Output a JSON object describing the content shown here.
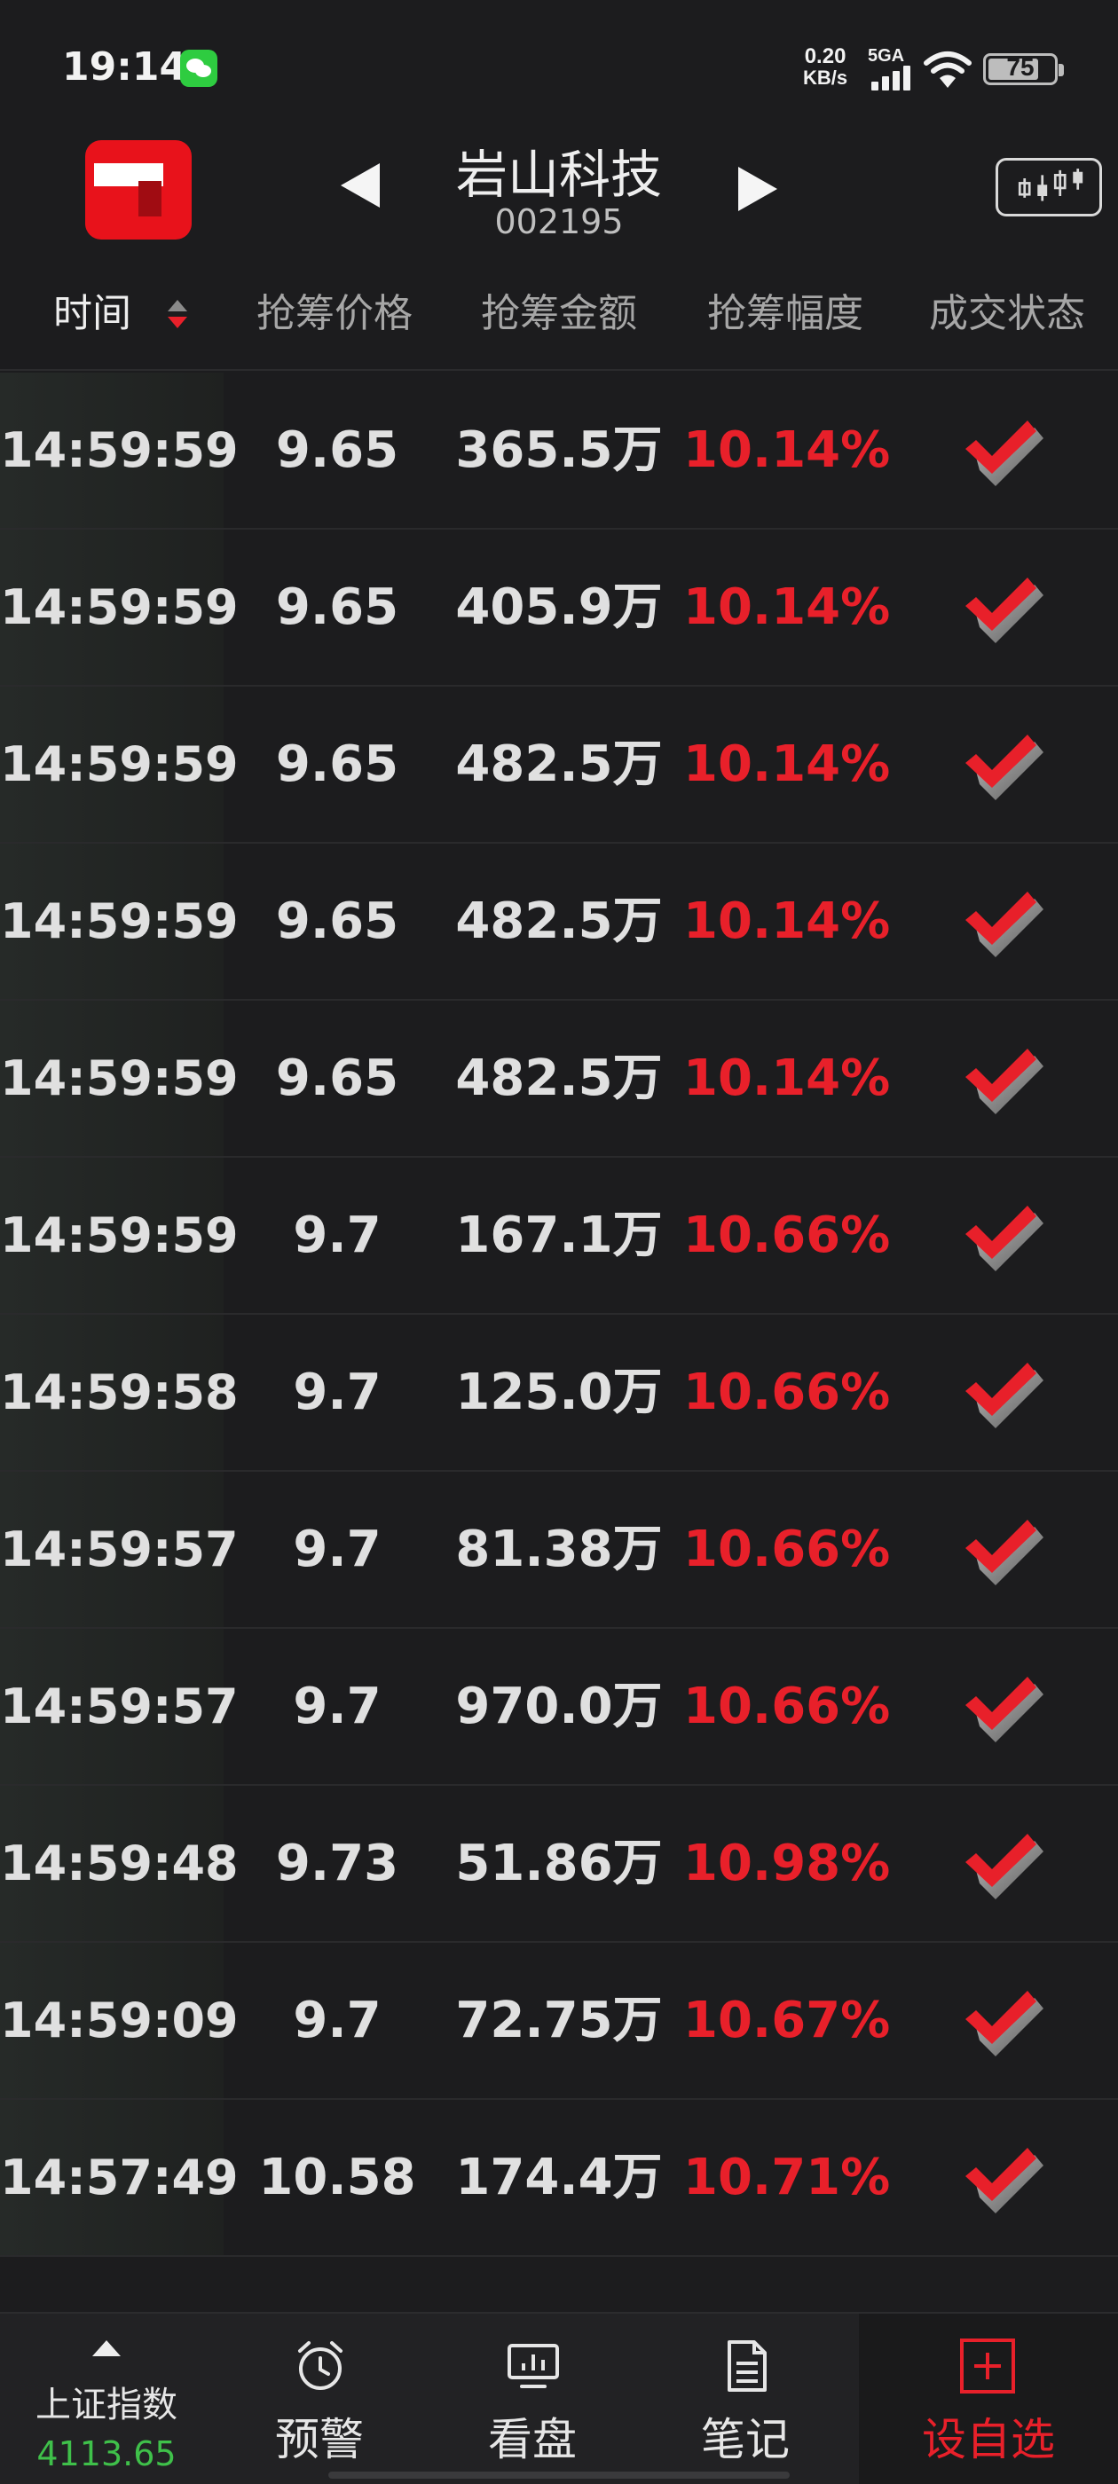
{
  "status_bar": {
    "time": "19:14",
    "net_speed_value": "0.20",
    "net_speed_unit": "KB/s",
    "network_type": "5GA",
    "battery": "75"
  },
  "header": {
    "stock_name": "岩山科技",
    "stock_code": "002195"
  },
  "table": {
    "columns": {
      "time": "时间",
      "price": "抢筹价格",
      "amount": "抢筹金额",
      "rate": "抢筹幅度",
      "status": "成交状态"
    },
    "rows": [
      {
        "time": "14:59:59",
        "price": "9.65",
        "amount": "365.5万",
        "rate": "10.14%"
      },
      {
        "time": "14:59:59",
        "price": "9.65",
        "amount": "405.9万",
        "rate": "10.14%"
      },
      {
        "time": "14:59:59",
        "price": "9.65",
        "amount": "482.5万",
        "rate": "10.14%"
      },
      {
        "time": "14:59:59",
        "price": "9.65",
        "amount": "482.5万",
        "rate": "10.14%"
      },
      {
        "time": "14:59:59",
        "price": "9.65",
        "amount": "482.5万",
        "rate": "10.14%"
      },
      {
        "time": "14:59:59",
        "price": "9.7",
        "amount": "167.1万",
        "rate": "10.66%"
      },
      {
        "time": "14:59:58",
        "price": "9.7",
        "amount": "125.0万",
        "rate": "10.66%"
      },
      {
        "time": "14:59:57",
        "price": "9.7",
        "amount": "81.38万",
        "rate": "10.66%"
      },
      {
        "time": "14:59:57",
        "price": "9.7",
        "amount": "970.0万",
        "rate": "10.66%"
      },
      {
        "time": "14:59:48",
        "price": "9.73",
        "amount": "51.86万",
        "rate": "10.98%"
      },
      {
        "time": "14:59:09",
        "price": "9.7",
        "amount": "72.75万",
        "rate": "10.67%"
      },
      {
        "time": "14:57:49",
        "price": "10.58",
        "amount": "174.4万",
        "rate": "10.71%"
      }
    ]
  },
  "bottom_nav": {
    "index_name": "上证指数",
    "index_value": "4113.65",
    "alert": "预警",
    "watch": "看盘",
    "notes": "笔记",
    "add_favorite": "设自选"
  },
  "colors": {
    "up_red": "#e8202a",
    "index_green": "#3fc04a",
    "background": "#1c1c1e"
  }
}
